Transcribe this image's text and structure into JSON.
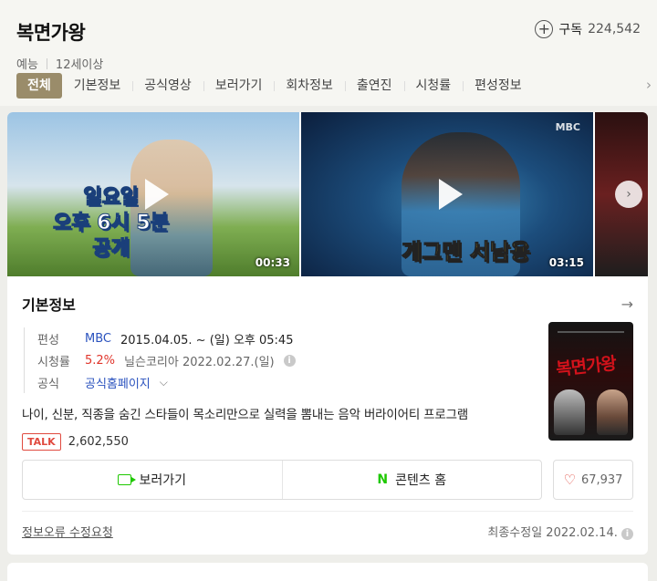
{
  "header": {
    "title": "복면가왕",
    "subscribe_label": "구독",
    "subscribe_count": "224,542",
    "genre": "예능",
    "rating_age": "12세이상"
  },
  "tabs": [
    {
      "label": "전체",
      "active": true
    },
    {
      "label": "기본정보"
    },
    {
      "label": "공식영상"
    },
    {
      "label": "보러가기"
    },
    {
      "label": "회차정보"
    },
    {
      "label": "출연진"
    },
    {
      "label": "시청률"
    },
    {
      "label": "편성정보"
    }
  ],
  "videos": [
    {
      "duration": "00:33",
      "caption": "일요일\n오후 6시 5분\n공개"
    },
    {
      "duration": "03:15",
      "caption": "개그맨 서남용",
      "channel": "MBC"
    }
  ],
  "info": {
    "section_title": "기본정보",
    "schedule_label": "편성",
    "channel": "MBC",
    "schedule": "2015.04.05. ~ (일) 오후 05:45",
    "rating_label": "시청률",
    "rating_value": "5.2%",
    "rating_source": "닐슨코리아 2022.02.27.(일)",
    "official_label": "공식",
    "official_link": "공식홈페이지",
    "description": "나이, 신분, 직종을 숨긴 스타들이 목소리만으로 실력을 뽐내는 음악 버라이어티 프로그램",
    "talk_badge": "TALK",
    "talk_count": "2,602,550",
    "poster_title": "복면가왕"
  },
  "actions": {
    "watch_label": "보러가기",
    "content_home_label": "콘텐츠 홈",
    "like_count": "67,937"
  },
  "footer": {
    "report_label": "정보오류 수정요청",
    "updated": "최종수정일 2022.02.14."
  },
  "colors": {
    "active_tab": "#9a8c6a",
    "link_blue": "#2a52be",
    "rating_red": "#e0352b",
    "naver_green": "#1ec800"
  }
}
